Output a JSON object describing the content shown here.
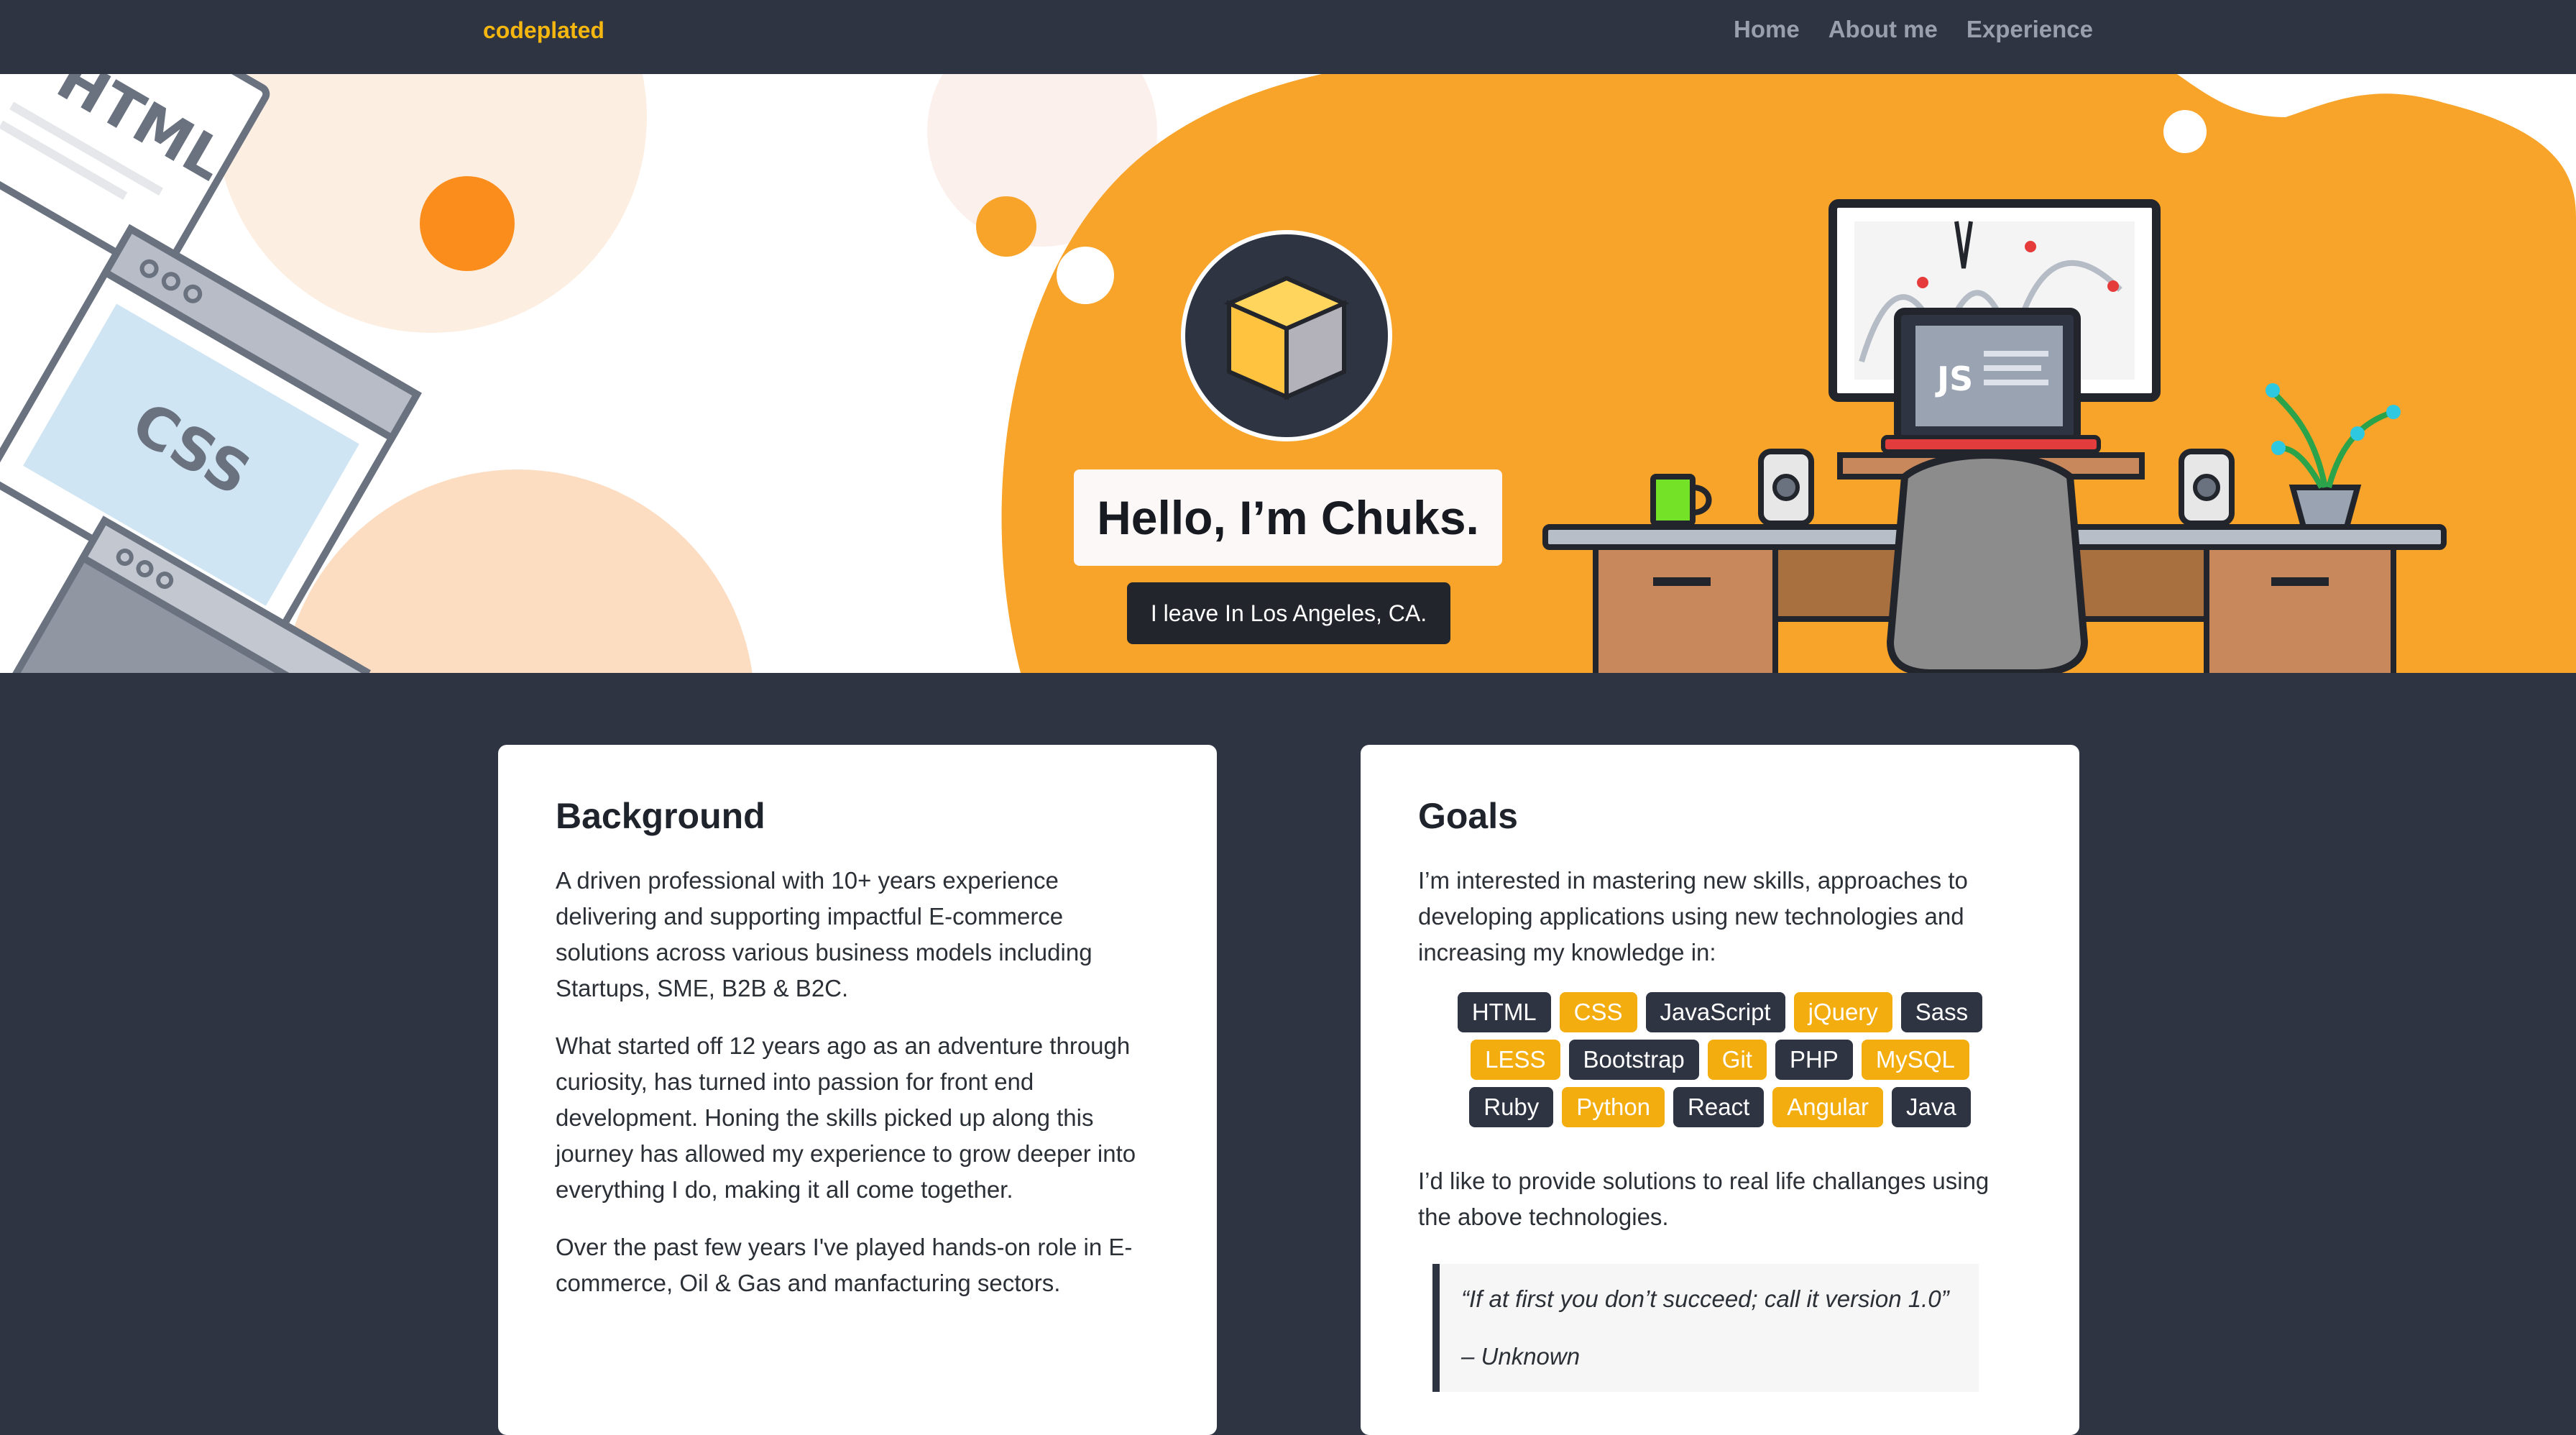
{
  "nav": {
    "brand": "codeplated",
    "links": [
      "Home",
      "About me",
      "Experience"
    ]
  },
  "hero": {
    "title": "Hello, I’m Chuks.",
    "subtitle": "I leave In Los Angeles, CA.",
    "illustration_labels": {
      "html": "HTML",
      "css": "CSS",
      "js": "JS"
    }
  },
  "background": {
    "heading": "Background",
    "paragraphs": [
      "A driven professional with 10+ years experience delivering and supporting impactful E-commerce solutions across various business models including Startups, SME, B2B & B2C.",
      "What started off 12 years ago as an adventure through curiosity, has turned into passion for front end development. Honing the skills picked up along this journey has allowed my experience to grow deeper into everything I do, making it all come together.",
      "Over the past few years I've played hands-on role in E-commerce, Oil & Gas and manfacturing sectors."
    ]
  },
  "goals": {
    "heading": "Goals",
    "intro": "I’m interested in mastering new skills, approaches to developing applications using new technologies and increasing my knowledge in:",
    "tags": [
      {
        "label": "HTML",
        "style": "dark"
      },
      {
        "label": "CSS",
        "style": "gold"
      },
      {
        "label": "JavaScript",
        "style": "dark"
      },
      {
        "label": "jQuery",
        "style": "gold"
      },
      {
        "label": "Sass",
        "style": "dark"
      },
      {
        "label": "LESS",
        "style": "gold"
      },
      {
        "label": "Bootstrap",
        "style": "dark"
      },
      {
        "label": "Git",
        "style": "gold"
      },
      {
        "label": "PHP",
        "style": "dark"
      },
      {
        "label": "MySQL",
        "style": "gold"
      },
      {
        "label": "Ruby",
        "style": "dark"
      },
      {
        "label": "Python",
        "style": "gold"
      },
      {
        "label": "React",
        "style": "dark"
      },
      {
        "label": "Angular",
        "style": "gold"
      },
      {
        "label": "Java",
        "style": "dark"
      }
    ],
    "outro": "I’d like to provide solutions to real life challanges using the above technologies.",
    "quote": "“If at first you don’t succeed; call it version 1.0”",
    "quote_author": "– Unknown"
  },
  "colors": {
    "nav_bg": "#2e3442",
    "brand": "#f5b70f",
    "accent_orange": "#f8a42a",
    "tag_dark": "#2e3442",
    "tag_gold": "#f4ad0e"
  }
}
